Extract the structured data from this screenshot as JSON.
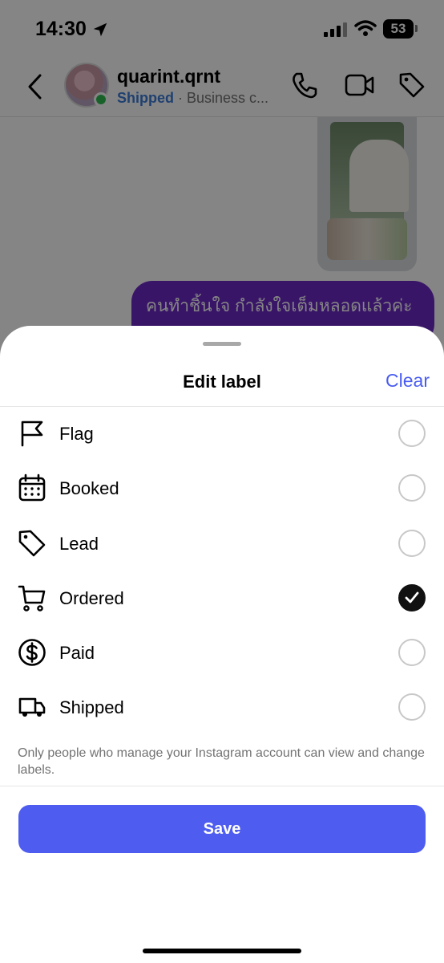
{
  "status_bar": {
    "time": "14:30",
    "battery": "53"
  },
  "header": {
    "contact_name": "quarint.qrnt",
    "contact_status": "Shipped",
    "contact_separator": " · ",
    "contact_subtitle": "Business c..."
  },
  "chat": {
    "message_text": "คนทำชิ้นใจ กำลังใจเต็มหลอดแล้วค่ะ"
  },
  "sheet": {
    "title": "Edit label",
    "clear_label": "Clear",
    "labels": [
      {
        "label": "Flag",
        "icon": "flag-icon",
        "checked": false
      },
      {
        "label": "Booked",
        "icon": "calendar-icon",
        "checked": false
      },
      {
        "label": "Lead",
        "icon": "tag-icon",
        "checked": false
      },
      {
        "label": "Ordered",
        "icon": "cart-icon",
        "checked": true
      },
      {
        "label": "Paid",
        "icon": "dollar-icon",
        "checked": false
      },
      {
        "label": "Shipped",
        "icon": "truck-icon",
        "checked": false
      }
    ],
    "note": "Only people who manage your Instagram account can view and change labels.",
    "save_label": "Save"
  },
  "colors": {
    "accent": "#4e5df0",
    "message_bubble": "#6e2ac8",
    "online": "#2ebd52"
  }
}
